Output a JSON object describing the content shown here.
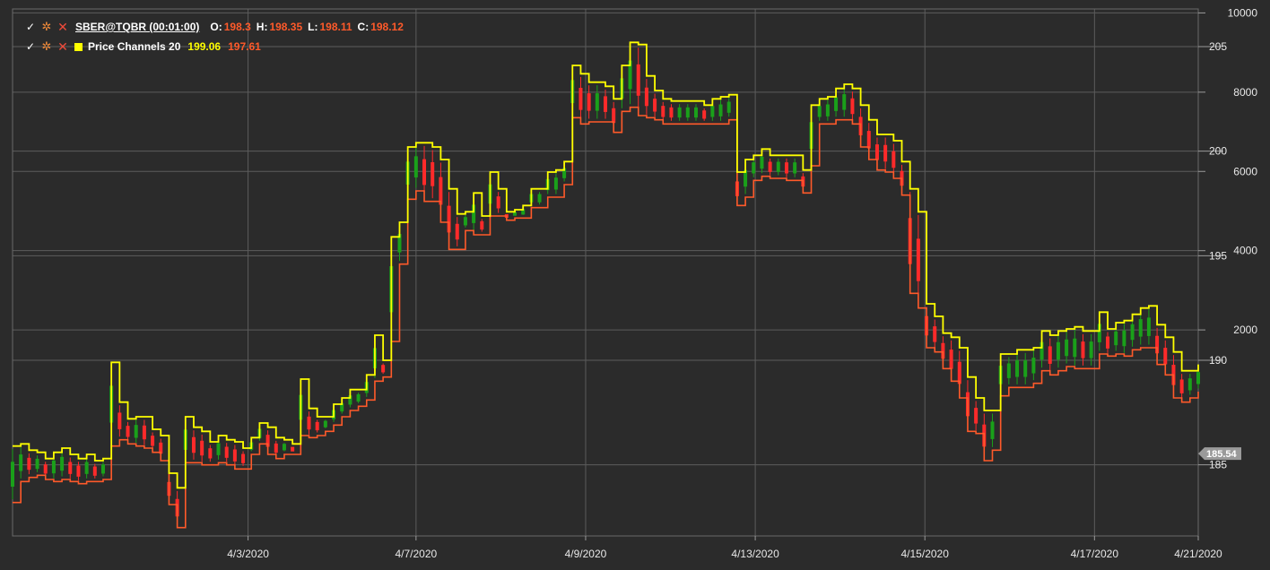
{
  "legend": {
    "instrument": {
      "symbol": "SBER@TQBR (00:01:00)",
      "o_label": "O:",
      "o_value": "198.3",
      "h_label": "H:",
      "h_value": "198.35",
      "l_label": "L:",
      "l_value": "198.11",
      "c_label": "C:",
      "c_value": "198.12"
    },
    "indicator": {
      "name": "Price Channels 20",
      "upper": "199.06",
      "lower": "197.61"
    },
    "icons": [
      "check-icon",
      "gear-icon",
      "close-icon"
    ]
  },
  "colors": {
    "background": "#2b2b2b",
    "grid": "#5c5c5c",
    "upper_channel": "#ffff00",
    "lower_channel": "#ff5a2a",
    "candle_up": "#1aa01a",
    "candle_down": "#ff2a2a",
    "last_price_badge": "#9a9a9a"
  },
  "chart_data": {
    "type": "line",
    "title": "",
    "x_tick_labels": [
      "4/3/2020",
      "4/7/2020",
      "4/9/2020",
      "4/13/2020",
      "4/15/2020",
      "4/17/2020",
      "4/21/2020"
    ],
    "price_axis": {
      "ticks": [
        185,
        190,
        195,
        200,
        205
      ],
      "range": [
        181.6,
        206.8
      ]
    },
    "volume_axis": {
      "ticks": [
        2000,
        4000,
        6000,
        8000,
        10000
      ],
      "range": [
        -3200,
        10100
      ]
    },
    "last_price": "185.54",
    "series": [
      {
        "role": "upper-channel",
        "x": [
          0,
          1,
          2,
          3,
          4,
          5,
          6,
          7,
          8,
          9,
          10,
          11,
          12,
          13,
          14,
          15,
          16,
          17,
          18,
          19,
          20,
          21,
          22,
          23,
          24,
          25,
          26,
          27,
          28,
          29,
          30,
          31,
          32,
          33,
          34,
          35,
          36,
          37,
          38,
          39,
          40,
          41,
          42,
          43,
          44,
          45,
          46,
          47,
          48,
          49,
          50,
          51,
          52,
          53,
          54,
          55,
          56,
          57,
          58,
          59,
          60,
          61,
          62,
          63,
          64,
          65,
          66,
          67,
          68,
          69,
          70,
          71,
          72,
          73,
          74,
          75,
          76,
          77,
          78,
          79,
          80,
          81,
          82,
          83,
          84,
          85,
          86,
          87,
          88,
          89,
          90,
          91,
          92,
          93,
          94,
          95,
          96,
          97,
          98,
          99,
          100,
          101,
          102,
          103,
          104,
          105,
          106,
          107,
          108,
          109,
          110,
          111,
          112,
          113,
          114,
          115,
          116,
          117,
          118,
          119,
          120,
          121,
          122,
          123,
          124,
          125,
          126,
          127,
          128,
          129,
          130,
          131,
          132,
          133,
          134,
          135,
          136,
          137,
          138,
          139,
          140,
          141,
          142,
          143,
          144
        ],
        "values": [
          185.9,
          186.0,
          185.7,
          185.6,
          185.3,
          185.6,
          185.8,
          185.5,
          185.3,
          185.5,
          185.2,
          185.3,
          189.9,
          188.0,
          187.2,
          187.3,
          187.3,
          186.7,
          186.4,
          184.6,
          183.9,
          187.3,
          186.8,
          186.6,
          186.1,
          186.4,
          186.2,
          186.1,
          185.8,
          186.3,
          187.0,
          186.8,
          186.3,
          186.2,
          186.0,
          189.1,
          187.7,
          187.3,
          187.3,
          187.9,
          188.2,
          188.6,
          188.6,
          189.3,
          191.2,
          190.0,
          195.9,
          196.6,
          200.2,
          200.4,
          200.4,
          200.2,
          199.6,
          198.2,
          197.0,
          197.1,
          198.0,
          196.9,
          199.0,
          198.2,
          197.1,
          197.2,
          197.4,
          198.2,
          198.2,
          199.0,
          199.1,
          199.5,
          204.1,
          203.7,
          203.3,
          203.3,
          203.1,
          202.5,
          204.1,
          205.2,
          205.1,
          203.6,
          202.9,
          202.5,
          202.4,
          202.4,
          202.4,
          202.4,
          202.2,
          202.5,
          202.6,
          202.7,
          199.0,
          199.6,
          199.8,
          200.1,
          199.8,
          199.8,
          199.8,
          199.8,
          199.1,
          202.2,
          202.5,
          202.6,
          203.0,
          203.2,
          203.0,
          202.2,
          201.5,
          200.8,
          200.8,
          200.5,
          199.5,
          198.2,
          197.1,
          192.7,
          192.1,
          191.3,
          191.1,
          190.6,
          189.2,
          188.2,
          187.6,
          187.6,
          190.3,
          190.3,
          190.5,
          190.5,
          190.6,
          191.4,
          191.2,
          191.4,
          191.5,
          191.6,
          191.4,
          191.4,
          192.3,
          191.5,
          191.8,
          191.9,
          192.2,
          192.5,
          192.6,
          191.7,
          191.1,
          190.4,
          189.5,
          189.5,
          189.8
        ]
      },
      {
        "role": "lower-channel",
        "x": [
          0,
          1,
          2,
          3,
          4,
          5,
          6,
          7,
          8,
          9,
          10,
          11,
          12,
          13,
          14,
          15,
          16,
          17,
          18,
          19,
          20,
          21,
          22,
          23,
          24,
          25,
          26,
          27,
          28,
          29,
          30,
          31,
          32,
          33,
          34,
          35,
          36,
          37,
          38,
          39,
          40,
          41,
          42,
          43,
          44,
          45,
          46,
          47,
          48,
          49,
          50,
          51,
          52,
          53,
          54,
          55,
          56,
          57,
          58,
          59,
          60,
          61,
          62,
          63,
          64,
          65,
          66,
          67,
          68,
          69,
          70,
          71,
          72,
          73,
          74,
          75,
          76,
          77,
          78,
          79,
          80,
          81,
          82,
          83,
          84,
          85,
          86,
          87,
          88,
          89,
          90,
          91,
          92,
          93,
          94,
          95,
          96,
          97,
          98,
          99,
          100,
          101,
          102,
          103,
          104,
          105,
          106,
          107,
          108,
          109,
          110,
          111,
          112,
          113,
          114,
          115,
          116,
          117,
          118,
          119,
          120,
          121,
          122,
          123,
          124,
          125,
          126,
          127,
          128,
          129,
          130,
          131,
          132,
          133,
          134,
          135,
          136,
          137,
          138,
          139,
          140,
          141,
          142,
          143,
          144
        ],
        "values": [
          183.2,
          184.2,
          184.4,
          184.5,
          184.3,
          184.2,
          184.3,
          184.2,
          184.1,
          184.2,
          184.2,
          184.3,
          185.9,
          186.2,
          186.0,
          185.9,
          185.8,
          185.6,
          185.2,
          183.1,
          182.0,
          185.1,
          185.1,
          185.0,
          185.0,
          185.1,
          185.0,
          184.8,
          184.8,
          185.5,
          186.0,
          185.5,
          185.3,
          185.5,
          185.5,
          186.4,
          186.3,
          186.4,
          186.6,
          186.9,
          187.3,
          187.6,
          187.8,
          188.1,
          189.0,
          189.2,
          190.9,
          194.6,
          197.7,
          198.1,
          197.6,
          197.6,
          196.6,
          195.3,
          195.3,
          196.2,
          196.0,
          196.0,
          196.9,
          196.9,
          196.7,
          196.8,
          196.8,
          197.3,
          197.3,
          197.8,
          197.8,
          198.4,
          201.6,
          201.3,
          201.4,
          201.4,
          201.4,
          200.9,
          201.9,
          202.1,
          201.7,
          201.6,
          201.5,
          201.3,
          201.3,
          201.3,
          201.3,
          201.3,
          201.3,
          201.3,
          201.3,
          201.5,
          197.4,
          197.8,
          198.6,
          198.8,
          198.7,
          198.7,
          198.6,
          198.6,
          198.0,
          199.3,
          201.3,
          201.3,
          201.5,
          201.5,
          201.3,
          200.2,
          199.6,
          199.1,
          199.0,
          198.7,
          197.9,
          193.2,
          192.5,
          190.6,
          190.4,
          189.6,
          189.0,
          188.2,
          186.6,
          186.5,
          185.2,
          185.7,
          188.3,
          188.7,
          188.7,
          188.7,
          188.9,
          189.5,
          189.3,
          189.5,
          189.7,
          189.6,
          189.6,
          189.6,
          190.3,
          190.2,
          190.3,
          190.2,
          190.5,
          190.6,
          190.6,
          189.8,
          189.3,
          188.2,
          188.0,
          188.2,
          188.5
        ]
      }
    ]
  }
}
